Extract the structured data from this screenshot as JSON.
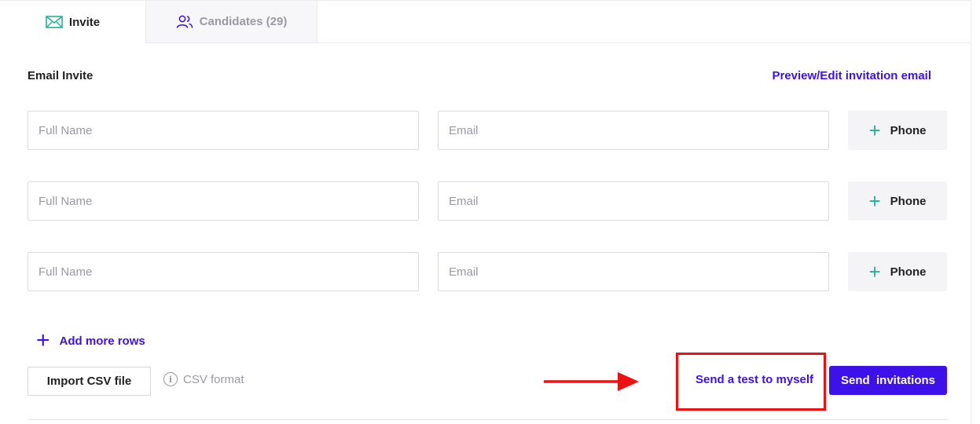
{
  "tabs": [
    {
      "label": "Invite",
      "icon": "envelope-icon",
      "active": true,
      "color": "#22b39a"
    },
    {
      "label": "Candidates (29)",
      "icon": "users-icon",
      "active": false,
      "color": "#3d11ea"
    }
  ],
  "email_invite": {
    "title": "Email Invite",
    "preview_link": "Preview/Edit invitation email"
  },
  "rows": [
    {
      "name_placeholder": "Full Name",
      "email_placeholder": "Email",
      "phone_label": "Phone"
    },
    {
      "name_placeholder": "Full Name",
      "email_placeholder": "Email",
      "phone_label": "Phone"
    },
    {
      "name_placeholder": "Full Name",
      "email_placeholder": "Email",
      "phone_label": "Phone"
    }
  ],
  "add_rows_label": "Add more rows",
  "import_csv_label": "Import CSV file",
  "csv_format_label": "CSV format",
  "send_test_label": "Send a test to myself",
  "send_invitations_label": "Send  invitations",
  "colors": {
    "accent": "#3d11ea",
    "teal": "#22b39a",
    "annotation_red": "#ee1111"
  }
}
